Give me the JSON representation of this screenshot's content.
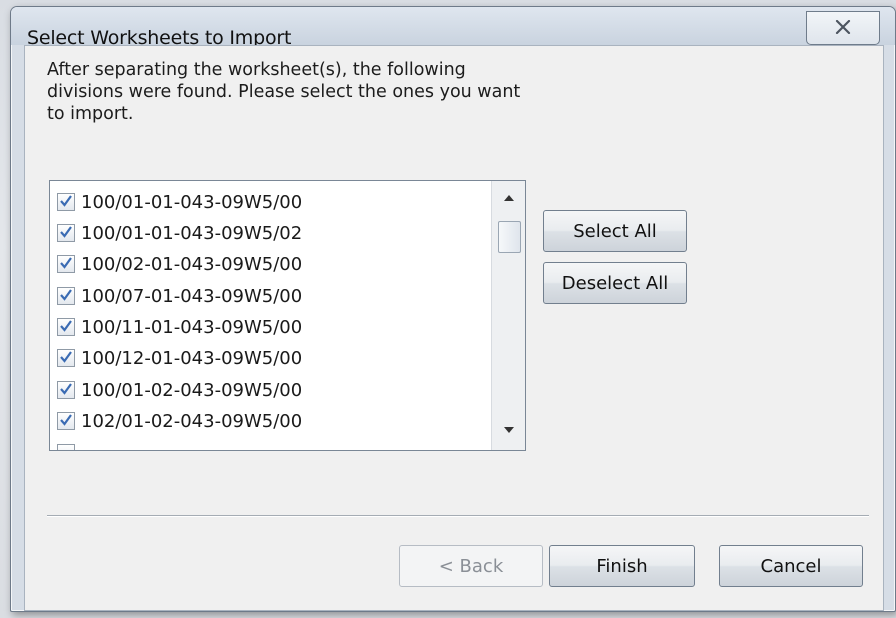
{
  "dialog": {
    "title": "Select Worksheets to Import",
    "instructions": "After separating the worksheet(s), the following divisions were found. Please select the ones you want to import."
  },
  "list": {
    "items": [
      {
        "label": "100/01-01-043-09W5/00",
        "checked": true
      },
      {
        "label": "100/01-01-043-09W5/02",
        "checked": true
      },
      {
        "label": "100/02-01-043-09W5/00",
        "checked": true
      },
      {
        "label": "100/07-01-043-09W5/00",
        "checked": true
      },
      {
        "label": "100/11-01-043-09W5/00",
        "checked": true
      },
      {
        "label": "100/12-01-043-09W5/00",
        "checked": true
      },
      {
        "label": "100/01-02-043-09W5/00",
        "checked": true
      },
      {
        "label": "102/01-02-043-09W5/00",
        "checked": true
      }
    ]
  },
  "buttons": {
    "select_all": "Select All",
    "deselect_all": "Deselect All",
    "back": "< Back",
    "finish": "Finish",
    "cancel": "Cancel"
  },
  "icons": {
    "close": "close-icon",
    "check": "check-icon",
    "scroll_up": "scroll-up-arrow-icon",
    "scroll_down": "scroll-down-arrow-icon"
  },
  "colors": {
    "accent": "#6d8fc9",
    "window_frame": "#d6dde6",
    "client": "#f0f0f0"
  }
}
